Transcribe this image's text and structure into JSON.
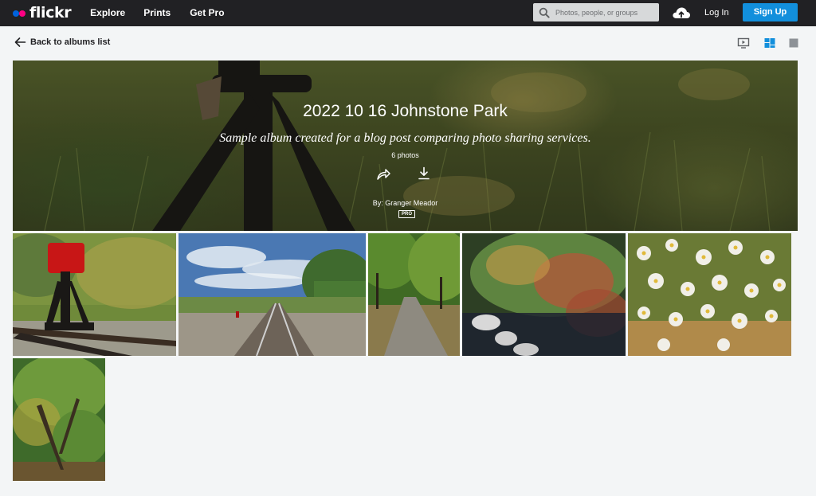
{
  "brand": {
    "name": "flickr",
    "dot_colors": [
      "#0063dc",
      "#ff0084"
    ]
  },
  "nav": {
    "explore": "Explore",
    "prints": "Prints",
    "get_pro": "Get Pro"
  },
  "search": {
    "placeholder": "Photos, people, or groups"
  },
  "header_actions": {
    "upload_icon": "cloud-upload-icon",
    "login": "Log In",
    "signup": "Sign Up",
    "signup_color": "#128fdc"
  },
  "subbar": {
    "back_label": "Back to albums list",
    "view_modes": [
      "slideshow-icon",
      "grid-icon",
      "single-photo-icon"
    ],
    "active_view": "grid-icon",
    "active_color": "#128fdc"
  },
  "album": {
    "title": "2022 10 16 Johnstone Park",
    "description": "Sample album created for a blog post comparing photo sharing services.",
    "photo_count": "6 photos",
    "byline": "By: Granger Meador",
    "pro_badge": "PRO",
    "actions": [
      "share-icon",
      "download-icon"
    ]
  },
  "photos": [
    {
      "subject": "red railroad switch stand on tracks"
    },
    {
      "subject": "railroad tracks under blue sky"
    },
    {
      "subject": "tree-lined park path"
    },
    {
      "subject": "autumn shrub beside creek rocks"
    },
    {
      "subject": "white aster flowers"
    },
    {
      "subject": "green tree foliage"
    }
  ]
}
